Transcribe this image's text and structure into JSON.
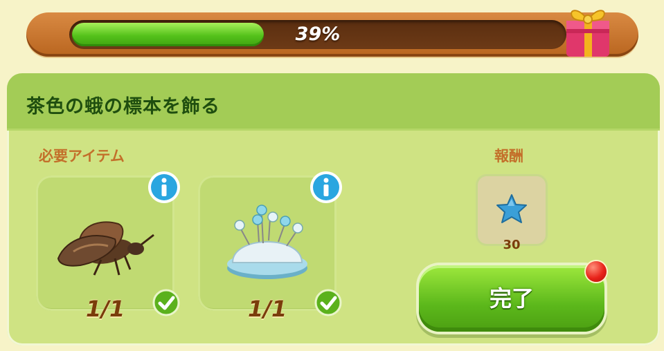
{
  "progress": {
    "percent_label": "39%",
    "fraction": 0.39,
    "fill_color": "#55c21b"
  },
  "quest": {
    "title": "茶色の蛾の標本を飾る",
    "required_label": "必要アイテム",
    "reward_label": "報酬",
    "items": [
      {
        "icon": "moth-specimen-icon",
        "count": "1/1",
        "complete": true
      },
      {
        "icon": "pin-cushion-icon",
        "count": "1/1",
        "complete": true
      }
    ],
    "reward": {
      "icon": "blue-star-icon",
      "amount": "30"
    },
    "complete_button_label": "完了"
  },
  "colors": {
    "panel": "#cfe383",
    "header": "#a3cc56",
    "title": "#1f4e0f",
    "accent_brown": "#7a3d0b",
    "section_label": "#c36f2a",
    "notification": "#e8231a"
  }
}
